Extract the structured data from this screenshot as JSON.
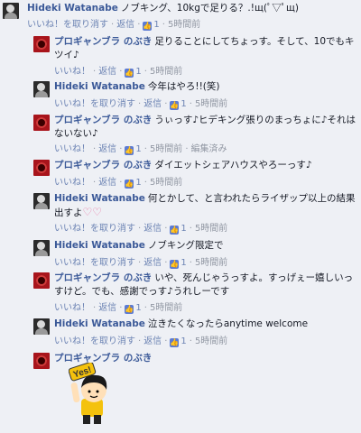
{
  "comments": [
    {
      "author": "Hideki Watanabe",
      "text": "ノブキング、10kgで足りる？.!щ(ﾟ▽ﾟщ)",
      "meta": {
        "like": "いいね！を取り消す",
        "reply": "返信",
        "likes": "1",
        "time": "5時間前"
      }
    },
    {
      "author": "プロギャンブラ のぶき",
      "text": "足りることにしてちょっす。そして、10でもキツイ♪",
      "meta": {
        "like": "いいね！",
        "reply": "返信",
        "likes": "1",
        "time": "5時間前"
      }
    },
    {
      "author": "Hideki Watanabe",
      "text": "今年はやろ!!(笑)",
      "meta": {
        "like": "いいね！を取り消す",
        "reply": "返信",
        "likes": "1",
        "time": "5時間前"
      }
    },
    {
      "author": "プロギャンブラ のぶき",
      "text": "うぃっす♪ヒデキング張りのまっちょに♪それはないない♪",
      "meta": {
        "like": "いいね！",
        "reply": "返信",
        "likes": "1",
        "time": "5時間前",
        "edited": "編集済み"
      }
    },
    {
      "author": "プロギャンブラ のぶき",
      "text": "ダイエットシェアハウスやろーっす♪",
      "meta": {
        "like": "いいね！",
        "reply": "返信",
        "likes": "1",
        "time": "5時間前"
      }
    },
    {
      "author": "Hideki Watanabe",
      "text": "何とかして、と言われたらライザップ以上の結果出すよ",
      "meta": {
        "like": "いいね！を取り消す",
        "reply": "返信",
        "likes": "1",
        "time": "5時間前"
      }
    },
    {
      "author": "Hideki Watanabe",
      "text": "ノブキング限定で",
      "meta": {
        "like": "いいね！を取り消す",
        "reply": "返信",
        "likes": "1",
        "time": "5時間前"
      }
    },
    {
      "author": "プロギャンブラ のぶき",
      "text": "いや、死んじゃうっすよ。すっげぇー嬉しいっすけど。でも、感謝でっす♪うれしーです",
      "meta": {
        "like": "いいね！",
        "reply": "返信",
        "likes": "1",
        "time": "5時間前"
      }
    },
    {
      "author": "Hideki Watanabe",
      "text": "泣きたくなったらanytime welcome",
      "meta": {
        "like": "いいね！を取り消す",
        "reply": "返信",
        "likes": "1",
        "time": "5時間前"
      }
    },
    {
      "author": "プロギャンブラ のぶき",
      "sticker_text": "Yes!"
    }
  ],
  "colors": {
    "link": "#3b5998",
    "meta": "#6d84b4",
    "muted": "#9197a3",
    "background": "#eef0f5"
  },
  "icons": {
    "like": "thumbs-up-icon",
    "heart": "heart-icon"
  }
}
